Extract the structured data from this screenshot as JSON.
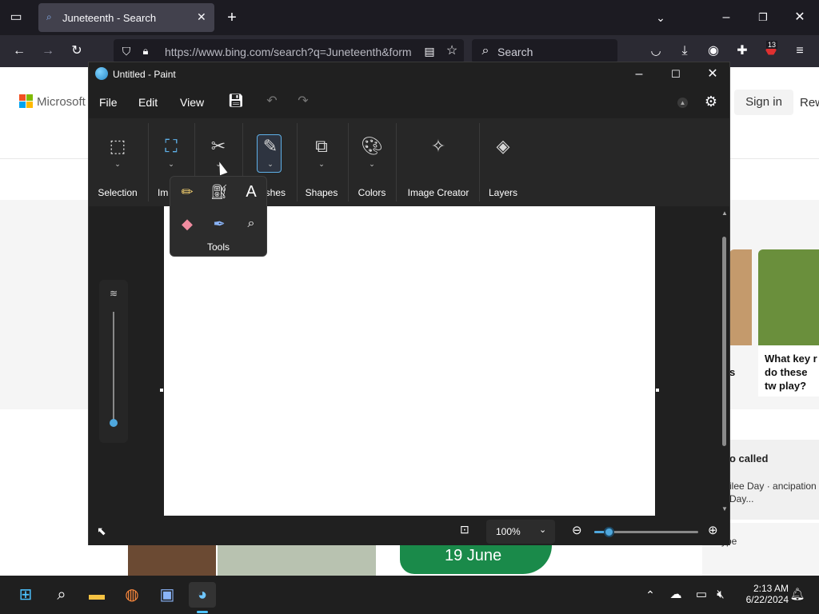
{
  "browser": {
    "tab_title": "Juneteenth - Search",
    "url": "https://www.bing.com/search?q=Juneteenth&form",
    "search_placeholder": "Search",
    "badge_count": "13"
  },
  "bing": {
    "brand": "Microsoft",
    "signin": "Sign in",
    "rewards": "Rew",
    "card1_text": "What key r do these tw play?",
    "card2_s": "s",
    "side_title": "o called",
    "side_sub": "ilee Day · ancipation Day...",
    "side_ype": "ype",
    "tile_text": "19 June"
  },
  "paint": {
    "title": "Untitled - Paint",
    "menu": [
      "File",
      "Edit",
      "View"
    ],
    "ribbon": {
      "selection": "Selection",
      "image": "Im",
      "brushes": "shes",
      "shapes": "Shapes",
      "colors": "Colors",
      "image_creator": "Image Creator",
      "layers": "Layers"
    },
    "tools_label": "Tools",
    "zoom": "100%",
    "zoom_slider": 0.14
  },
  "taskbar": {
    "time": "2:13 AM",
    "date": "6/22/2024"
  }
}
